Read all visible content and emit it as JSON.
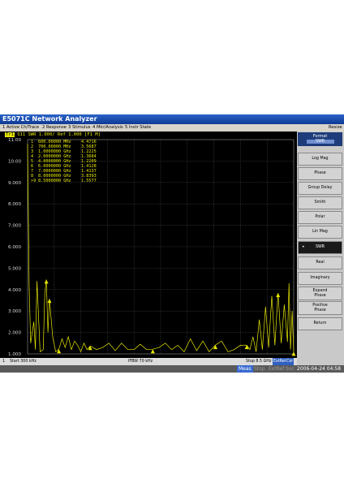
{
  "window": {
    "title": "E5071C Network Analyzer"
  },
  "menu": {
    "items": [
      "1 Active Ch/Trace",
      "2 Response",
      "3 Stimulus",
      "4 Mkr/Analysis",
      "5 Instr State"
    ],
    "resize": "Resize"
  },
  "channel": {
    "tag": "Tr1",
    "trace_label": "S11 SWR 1.000/ Ref 1.000 [F1 M]"
  },
  "markers": [
    {
      "id": "1",
      "freq": "600.00000 MHz",
      "value": "4.4716"
    },
    {
      "id": "2",
      "freq": "700.00000 MHz",
      "value": "3.5687"
    },
    {
      "id": "3",
      "freq": "1.0000000 GHz",
      "value": "1.2225"
    },
    {
      "id": "4",
      "freq": "2.0000000 GHz",
      "value": "1.3684"
    },
    {
      "id": "5",
      "freq": "4.0000000 GHz",
      "value": "1.2209"
    },
    {
      "id": "6",
      "freq": "6.0000000 GHz",
      "value": "1.4128"
    },
    {
      "id": "7",
      "freq": "7.0000000 GHz",
      "value": "1.4137"
    },
    {
      "id": "8",
      "freq": "8.0000000 GHz",
      "value": "3.8393"
    },
    {
      "id": ">9",
      "freq": "8.5000000 GHz",
      "value": "1.5577"
    }
  ],
  "y_ticks": [
    "11.00",
    "10.00",
    "9.000",
    "8.000",
    "7.000",
    "6.000",
    "5.000",
    "4.000",
    "3.000",
    "2.000",
    "1.000"
  ],
  "softkeys": {
    "header_title": "Format",
    "header_value": "SWR",
    "buttons": [
      "Log Mag",
      "Phase",
      "Group Delay",
      "Smith",
      "Polar",
      "Lin Mag",
      "SWR",
      "Real",
      "Imaginary",
      "Expand\nPhase",
      "Positive\nPhase",
      "Return"
    ],
    "selected": "SWR"
  },
  "status": {
    "channel": "1",
    "start": "Start 300 kHz",
    "ifbw": "IFBW 70 kHz",
    "stop": "Stop 8.5 GHz",
    "ext": "ExtRef",
    "cor": "Cor"
  },
  "bottom": {
    "meas": "Meas",
    "stop": "Stop",
    "extref": "ExtRef",
    "svc": "Svc",
    "datetime": "2006-04-24 04:58"
  },
  "colors": {
    "trace": "#e8e800",
    "grid": "#666666",
    "title_bar": "#1f4fb0"
  },
  "chart_data": {
    "type": "line",
    "xlabel": "",
    "ylabel": "",
    "xlim": [
      0.0003,
      8.5
    ],
    "ylim": [
      1.0,
      11.0
    ],
    "grid": true,
    "series": [
      {
        "x": [
          0.0003,
          0.05,
          0.1,
          0.2,
          0.25,
          0.3,
          0.4,
          0.5,
          0.55,
          0.6,
          0.65,
          0.7,
          0.8,
          0.9,
          1.0,
          1.1,
          1.2,
          1.3,
          1.4,
          1.5,
          1.6,
          1.7,
          1.8,
          1.9,
          2.0,
          2.2,
          2.4,
          2.6,
          2.8,
          3.0,
          3.2,
          3.4,
          3.6,
          3.8,
          4.0,
          4.2,
          4.4,
          4.6,
          4.8,
          5.0,
          5.2,
          5.4,
          5.6,
          5.8,
          6.0,
          6.2,
          6.4,
          6.6,
          6.8,
          7.0,
          7.1,
          7.2,
          7.3,
          7.4,
          7.5,
          7.6,
          7.7,
          7.8,
          7.9,
          8.0,
          8.1,
          8.2,
          8.3,
          8.35,
          8.4,
          8.45,
          8.5
        ],
        "values": [
          10.8,
          4.2,
          1.5,
          2.5,
          1.2,
          4.4,
          1.1,
          1.2,
          3.8,
          4.47,
          2.0,
          3.57,
          1.8,
          1.1,
          1.22,
          1.7,
          1.3,
          1.8,
          1.2,
          1.6,
          1.4,
          1.1,
          1.5,
          1.2,
          1.37,
          1.2,
          1.3,
          1.5,
          1.15,
          1.5,
          1.2,
          1.2,
          1.45,
          1.2,
          1.22,
          1.3,
          1.5,
          1.2,
          1.4,
          1.1,
          1.7,
          1.15,
          1.6,
          1.1,
          1.41,
          1.6,
          1.1,
          1.2,
          1.4,
          1.41,
          1.2,
          1.8,
          1.1,
          2.6,
          1.2,
          3.2,
          1.3,
          3.7,
          1.4,
          3.84,
          1.5,
          3.3,
          1.56,
          4.3,
          1.2,
          3.0,
          1.1
        ]
      }
    ],
    "markers_x": [
      0.6,
      0.7,
      1.0,
      2.0,
      4.0,
      6.0,
      7.0,
      8.0,
      8.5
    ]
  }
}
